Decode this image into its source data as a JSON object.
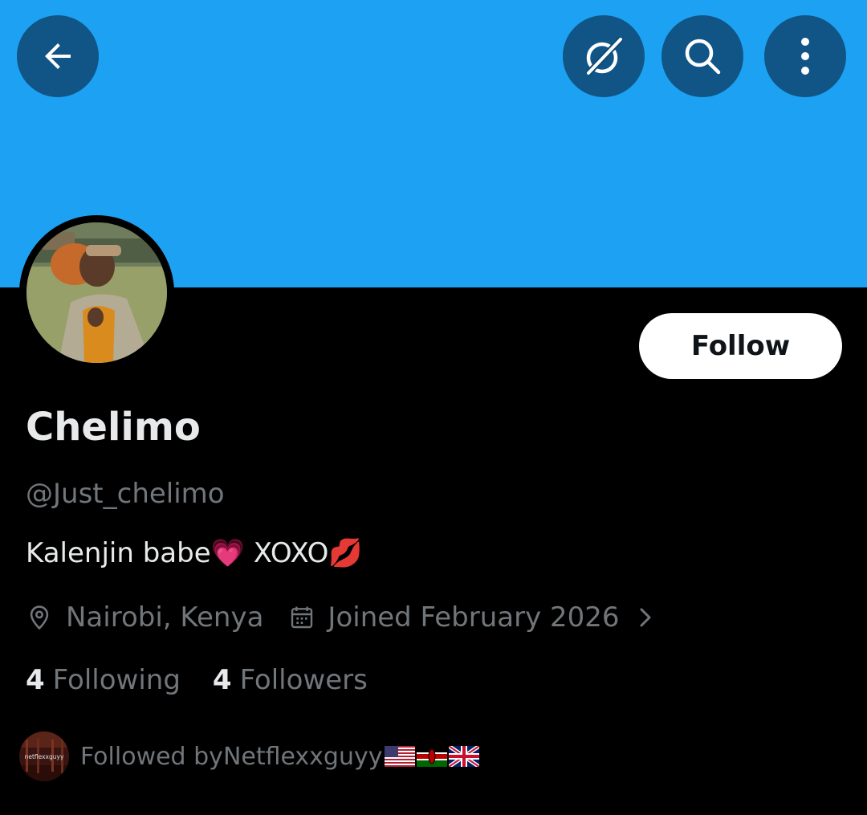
{
  "colors": {
    "banner": "#1da1f2",
    "background": "#000000",
    "primary_text": "#e7e9ea",
    "secondary_text": "#71767b",
    "follow_button_bg": "#ffffff",
    "follow_button_text": "#0f1419",
    "header_button_bg": "#0f4a76"
  },
  "header": {
    "back_icon": "arrow-left-icon",
    "grok_icon": "grok-icon",
    "search_icon": "search-icon",
    "more_icon": "more-vertical-icon"
  },
  "profile": {
    "display_name": "Chelimo",
    "handle": "@Just_chelimo",
    "bio_text": "Kalenjin babe",
    "bio_emoji_1": "💗",
    "bio_text_2": " XOXO",
    "bio_emoji_2": "💋",
    "location": "Nairobi, Kenya",
    "joined": "Joined February 2026",
    "follow_label": "Follow"
  },
  "stats": {
    "following_count": "4",
    "following_label": "Following",
    "followers_count": "4",
    "followers_label": "Followers"
  },
  "followed_by": {
    "prefix": "Followed by ",
    "name": "Netflexxguyy",
    "avatar_text": "netflexxguyy",
    "flags": [
      "us-flag",
      "kenya-flag",
      "uk-flag"
    ]
  }
}
